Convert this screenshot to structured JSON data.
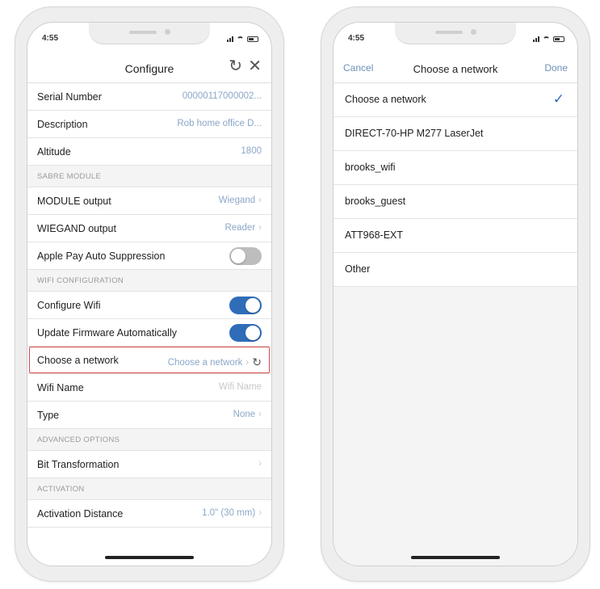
{
  "left_screen": {
    "status_time": "4:55",
    "nav": {
      "title": "Configure"
    },
    "rows": {
      "serial": {
        "label": "Serial Number",
        "value": "00000117000002..."
      },
      "description": {
        "label": "Description",
        "value": "Rob home office D..."
      },
      "altitude": {
        "label": "Altitude",
        "value": "1800"
      },
      "section_sabre": "SABRE MODULE",
      "module_output": {
        "label": "MODULE output",
        "value": "Wiegand"
      },
      "wiegand_output": {
        "label": "WIEGAND output",
        "value": "Reader"
      },
      "apple_pay": {
        "label": "Apple Pay Auto Suppression",
        "state": "off"
      },
      "section_wifi": "WIFI CONFIGURATION",
      "configure_wifi": {
        "label": "Configure Wifi",
        "state": "on"
      },
      "update_firmware": {
        "label": "Update Firmware Automatically",
        "state": "on"
      },
      "choose_network": {
        "label": "Choose a network",
        "value": "Choose a network"
      },
      "wifi_name": {
        "label": "Wifi Name",
        "placeholder": "Wifi Name"
      },
      "type": {
        "label": "Type",
        "value": "None"
      },
      "section_advanced": "ADVANCED OPTIONS",
      "bit_transformation": {
        "label": "Bit Transformation"
      },
      "section_activation": "ACTIVATION",
      "activation_distance": {
        "label": "Activation Distance",
        "value": "1.0\" (30 mm)"
      }
    }
  },
  "right_screen": {
    "status_time": "4:55",
    "nav": {
      "cancel": "Cancel",
      "title": "Choose a network",
      "done": "Done"
    },
    "networks": [
      {
        "name": "Choose a network",
        "selected": true
      },
      {
        "name": "DIRECT-70-HP M277 LaserJet",
        "selected": false
      },
      {
        "name": "brooks_wifi",
        "selected": false
      },
      {
        "name": "brooks_guest",
        "selected": false
      },
      {
        "name": "ATT968-EXT",
        "selected": false
      },
      {
        "name": "Other",
        "selected": false
      }
    ]
  },
  "colors": {
    "accent": "#2f6db8",
    "value_text": "#8ba7c8",
    "highlight": "#d84a4a"
  }
}
